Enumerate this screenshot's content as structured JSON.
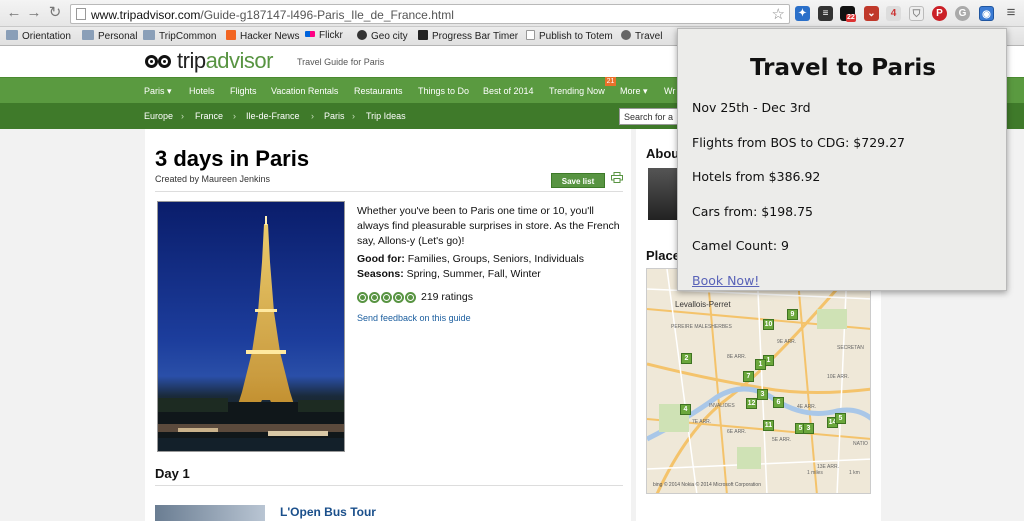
{
  "browser": {
    "url_host": "www.tripadvisor.com",
    "url_path": "/Guide-g187147-l496-Paris_Ile_de_France.html",
    "back_icon": "back-arrow-icon",
    "forward_icon": "forward-arrow-icon",
    "reload_icon": "reload-icon",
    "extension_badge_count": "22",
    "extension_small_count": "4"
  },
  "bookmarks": [
    {
      "label": "Orientation"
    },
    {
      "label": "Personal"
    },
    {
      "label": "TripCommon"
    },
    {
      "label": "Hacker News"
    },
    {
      "label": "Flickr"
    },
    {
      "label": "Geo city"
    },
    {
      "label": "Progress Bar Timer"
    },
    {
      "label": "Publish to Totem"
    },
    {
      "label": "Travel"
    }
  ],
  "site": {
    "logo_trip": "trip",
    "logo_advisor": "advisor",
    "tagline": "Travel Guide for Paris"
  },
  "mainnav": {
    "items": [
      "Paris ▾",
      "Hotels",
      "Flights",
      "Vacation Rentals",
      "Restaurants",
      "Things to Do",
      "Best of 2014",
      "Trending Now",
      "More ▾",
      "Wr"
    ],
    "trending_badge": "21"
  },
  "breadcrumb": {
    "items": [
      "Europe",
      "France",
      "Ile-de-France",
      "Paris",
      "Trip Ideas"
    ],
    "separator": "›",
    "search_placeholder": "Search for a"
  },
  "guide": {
    "title": "3 days in Paris",
    "created_by": "Created by Maureen Jenkins",
    "save_label": "Save list",
    "description": "Whether you've been to Paris one time or 10, you'll always find pleasurable surprises in store. As the French say, Allons-y (Let's go)!",
    "good_for_label": "Good for:",
    "good_for_value": " Families, Groups, Seniors, Individuals",
    "seasons_label": "Seasons:",
    "seasons_value": " Spring, Summer, Fall, Winter",
    "rating_bubbles_filled": 5,
    "ratings_text": "219 ratings",
    "feedback_link": "Send feedback on this guide",
    "day_title": "Day 1",
    "first_poi": "L'Open Bus Tour"
  },
  "sidebar": {
    "about_title": "Abou",
    "places_title": "Place"
  },
  "map": {
    "city_label": "Levallois-Perret",
    "pins": [
      "9",
      "10",
      "2",
      "1",
      "1",
      "7",
      "3",
      "6",
      "12",
      "4",
      "11",
      "5",
      "3",
      "14",
      "5"
    ],
    "labels": [
      "PEREIRE MALESHERBES",
      "8E ARR.",
      "SECRETAN",
      "9E ARR.",
      "10E ARR.",
      "INVALIDES",
      "7E ARR.",
      "4E ARR.",
      "6E ARR.",
      "NATIO",
      "5E ARR.",
      "13E ARR."
    ],
    "scale_miles": "1 miles",
    "scale_km": "1 km",
    "footer": "bing   © 2014 Nokia   © 2014 Microsoft Corporation"
  },
  "popup": {
    "title": "Travel to Paris",
    "dates": "Nov 25th - Dec 3rd",
    "flights": "Flights from BOS to CDG: $729.27",
    "hotels": "Hotels from $386.92",
    "cars": "Cars from: $198.75",
    "camel": "Camel Count: 9",
    "book_link": "Book Now!"
  },
  "colors": {
    "brand_green": "#589442",
    "nav_green": "#5a9a40",
    "subnav_green": "#3f7a2a",
    "link_blue": "#1a5d9e",
    "popup_link": "#5963b8"
  }
}
